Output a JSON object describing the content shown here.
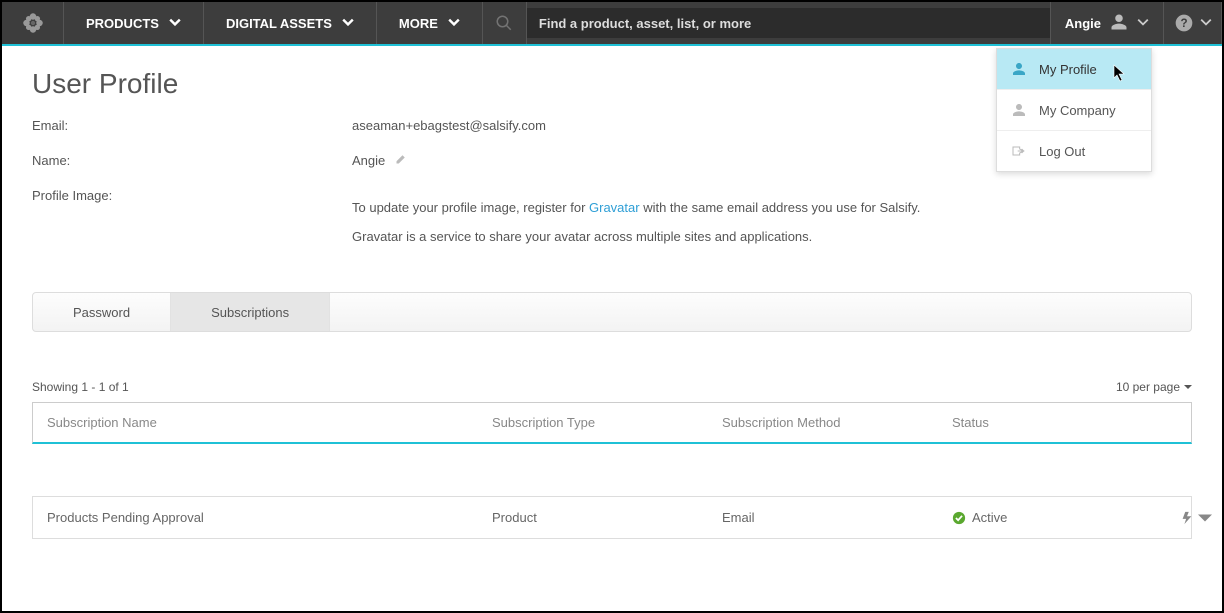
{
  "nav": {
    "products": "PRODUCTS",
    "assets": "DIGITAL ASSETS",
    "more": "MORE",
    "search_placeholder": "Find a product, asset, list, or more",
    "user": "Angie"
  },
  "user_menu": {
    "profile": "My Profile",
    "company": "My Company",
    "logout": "Log Out"
  },
  "page": {
    "title": "User Profile",
    "email_label": "Email:",
    "email_value": "aseaman+ebagstest@salsify.com",
    "name_label": "Name:",
    "name_value": "Angie",
    "image_label": "Profile Image:",
    "grav_text1a": "To update your profile image, register for ",
    "grav_link": "Gravatar",
    "grav_text1b": " with the same email address you use for Salsify.",
    "grav_text2": "Gravatar is a service to share your avatar across multiple sites and applications."
  },
  "tabs": {
    "password": "Password",
    "subscriptions": "Subscriptions"
  },
  "table": {
    "showing": "Showing 1 - 1 of 1",
    "per_page": "10 per page",
    "headers": {
      "name": "Subscription Name",
      "type": "Subscription Type",
      "method": "Subscription Method",
      "status": "Status"
    },
    "rows": [
      {
        "name": "Products Pending Approval",
        "type": "Product",
        "method": "Email",
        "status": "Active"
      }
    ]
  }
}
